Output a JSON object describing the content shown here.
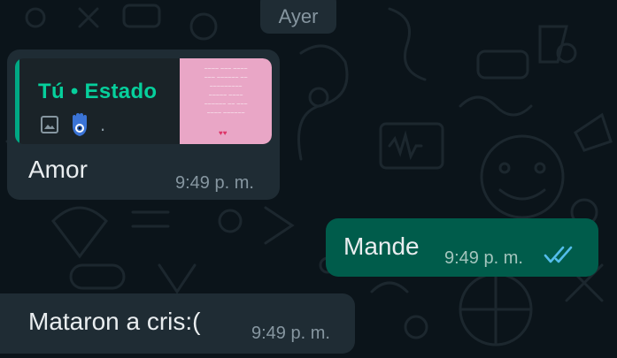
{
  "date_chip": "Ayer",
  "messages": [
    {
      "direction": "incoming",
      "reply": {
        "author": "Tú • Estado",
        "media_icon": "image-icon",
        "emoji_icon": "hamsa-icon",
        "trailing": ".",
        "thumbnail_color": "#e9a6c6"
      },
      "text": "Amor",
      "time": "9:49 p. m."
    },
    {
      "direction": "outgoing",
      "text": "Mande",
      "time": "9:49 p. m.",
      "status_icon": "double-check-read-icon"
    },
    {
      "direction": "incoming",
      "text": "Mataron a cris:(",
      "time": "9:49 p. m."
    }
  ],
  "colors": {
    "background": "#0b141a",
    "incoming_bubble": "#1f2c34",
    "outgoing_bubble": "#005c4b",
    "accent": "#00a884",
    "read_ticks": "#53bdeb"
  }
}
